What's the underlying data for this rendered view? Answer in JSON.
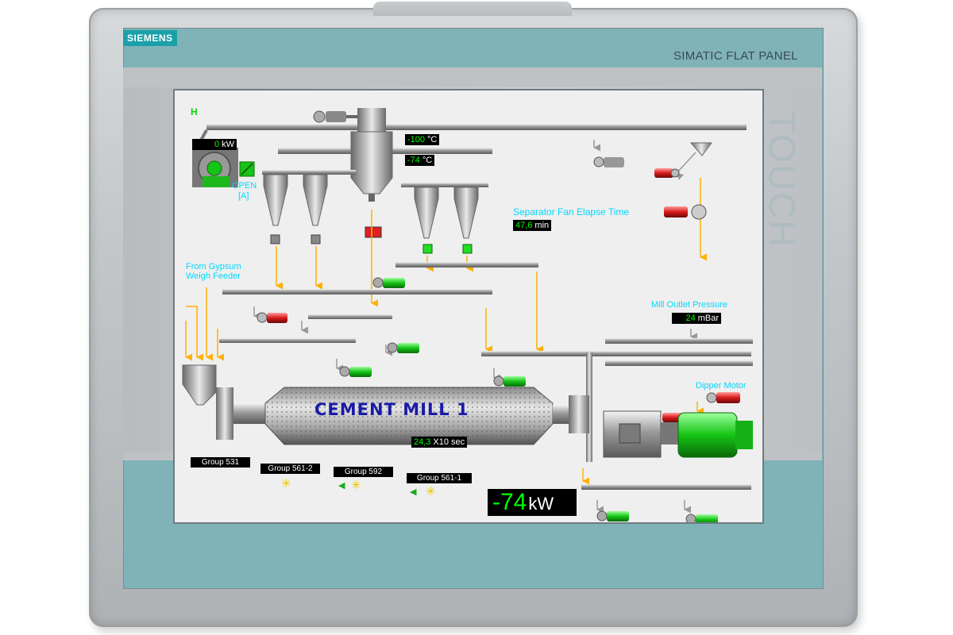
{
  "device": {
    "brand": "SIEMENS",
    "model": "SIMATIC FLAT PANEL",
    "touch_label": "TOUCH"
  },
  "colors": {
    "frame_teal": "#7fb3b8",
    "readout_green": "#00ff00",
    "label_cyan": "#00d9ff",
    "motor_green": "#00cc00",
    "motor_red": "#e02020",
    "flow_arrow": "#ffb000"
  },
  "hmi": {
    "corner_mark": "H",
    "fan_power": {
      "value": "0",
      "unit": "kW"
    },
    "damper_state": "OPEN",
    "damper_mode": "[A]",
    "temp1": {
      "value": "-100",
      "unit": "°C"
    },
    "temp2": {
      "value": "-74",
      "unit": "°C"
    },
    "separator_label": "Separator Fan Elapse Time",
    "separator_time": {
      "value": "47,6",
      "unit": "min"
    },
    "gypsum_label_1": "From Gypsum",
    "gypsum_label_2": "Weigh Feeder",
    "pressure_label": "Mill Outlet Pressure",
    "pressure": {
      "value": "24",
      "unit": "mBar"
    },
    "dipper_label": "Dipper Motor",
    "mill_title": "CEMENT MILL 1",
    "mill_speed": {
      "value": "24,3",
      "unit": "X10 sec"
    },
    "groups": [
      "Group 531",
      "Group 561-2",
      "Group 592",
      "Group 561-1"
    ],
    "main_power": {
      "value": "-74",
      "unit": "kW"
    }
  }
}
